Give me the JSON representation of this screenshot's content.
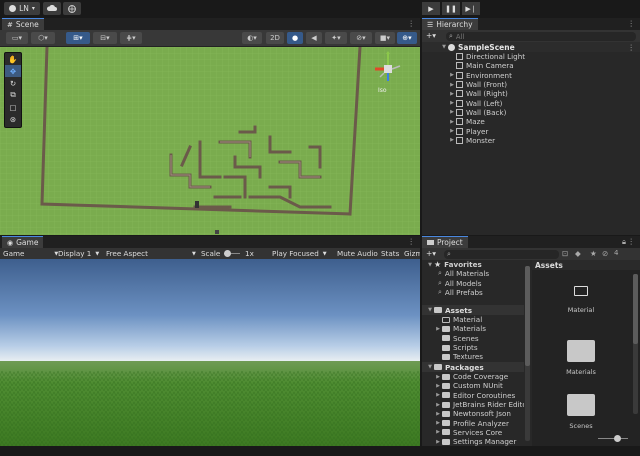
{
  "toolbar": {
    "account": "LN",
    "account_arrow": "▾",
    "cloud_icon": "cloud-icon",
    "collab_icon": "globe-icon"
  },
  "scene": {
    "tab": "Scene",
    "mode2d": "2D",
    "gizmo_label": "Iso"
  },
  "hierarchy": {
    "tab": "Hierarchy",
    "search_placeholder": "All",
    "scene_name": "SampleScene",
    "items": [
      {
        "label": "Directional Light",
        "arrow": ""
      },
      {
        "label": "Main Camera",
        "arrow": ""
      },
      {
        "label": "Environment",
        "arrow": "▶"
      },
      {
        "label": "Wall (Front)",
        "arrow": "▶"
      },
      {
        "label": "Wall (Right)",
        "arrow": "▶"
      },
      {
        "label": "Wall (Left)",
        "arrow": "▶"
      },
      {
        "label": "Wall (Back)",
        "arrow": "▶"
      },
      {
        "label": "Maze",
        "arrow": "▶"
      },
      {
        "label": "Player",
        "arrow": "▶"
      },
      {
        "label": "Monster",
        "arrow": "▶"
      }
    ]
  },
  "game": {
    "tab": "Game",
    "display_mode": "Game",
    "display": "Display 1",
    "aspect": "Free Aspect",
    "scale_label": "Scale",
    "scale_value": "1x",
    "play_focused": "Play Focused",
    "mute": "Mute Audio",
    "stats": "Stats",
    "gizmos": "Gizm"
  },
  "project": {
    "tab": "Project",
    "badge_count": "4",
    "favorites": {
      "title": "Favorites",
      "items": [
        "All Materials",
        "All Models",
        "All Prefabs"
      ]
    },
    "assets": {
      "title": "Assets",
      "items": [
        {
          "label": "Material",
          "arrow": ""
        },
        {
          "label": "Materials",
          "arrow": "▶"
        },
        {
          "label": "Scenes",
          "arrow": ""
        },
        {
          "label": "Scripts",
          "arrow": ""
        },
        {
          "label": "Textures",
          "arrow": ""
        }
      ]
    },
    "packages": {
      "title": "Packages",
      "items": [
        "Code Coverage",
        "Custom NUnit",
        "Editor Coroutines",
        "JetBrains Rider Editor",
        "Newtonsoft Json",
        "Profile Analyzer",
        "Services Core",
        "Settings Manager"
      ]
    },
    "grid_header": "Assets",
    "grid_items": [
      "Material",
      "Materials",
      "Scenes"
    ]
  }
}
